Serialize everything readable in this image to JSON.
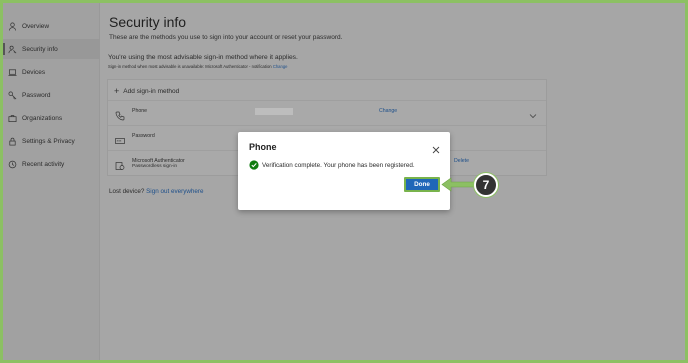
{
  "sidebar": {
    "items": [
      {
        "label": "Overview",
        "icon": "person-icon"
      },
      {
        "label": "Security info",
        "icon": "security-key-icon",
        "active": true
      },
      {
        "label": "Devices",
        "icon": "laptop-icon"
      },
      {
        "label": "Password",
        "icon": "key-icon"
      },
      {
        "label": "Organizations",
        "icon": "briefcase-icon"
      },
      {
        "label": "Settings & Privacy",
        "icon": "lock-icon"
      },
      {
        "label": "Recent activity",
        "icon": "history-icon"
      }
    ]
  },
  "main": {
    "title": "Security info",
    "subtitle": "These are the methods you use to sign into your account or reset your password.",
    "advisable_text": "You're using the most advisable sign-in method where it applies.",
    "advisable_sub_text": "Sign-in method when most advisable is unavailable: Microsoft Authenticator - notification",
    "advisable_change_link": "Change",
    "add_method_label": "Add sign-in method",
    "methods": [
      {
        "name": "Phone",
        "action": "Change"
      },
      {
        "name": "Password",
        "action": ""
      },
      {
        "name": "Microsoft Authenticator",
        "sub": "Passwordless sign-in",
        "action": "Delete"
      }
    ],
    "lost_device_text": "Lost device?",
    "lost_device_link": "Sign out everywhere"
  },
  "dialog": {
    "title": "Phone",
    "message": "Verification complete. Your phone has been registered.",
    "done_label": "Done"
  },
  "callout": {
    "step_number": "7",
    "color": "#8cc063"
  }
}
